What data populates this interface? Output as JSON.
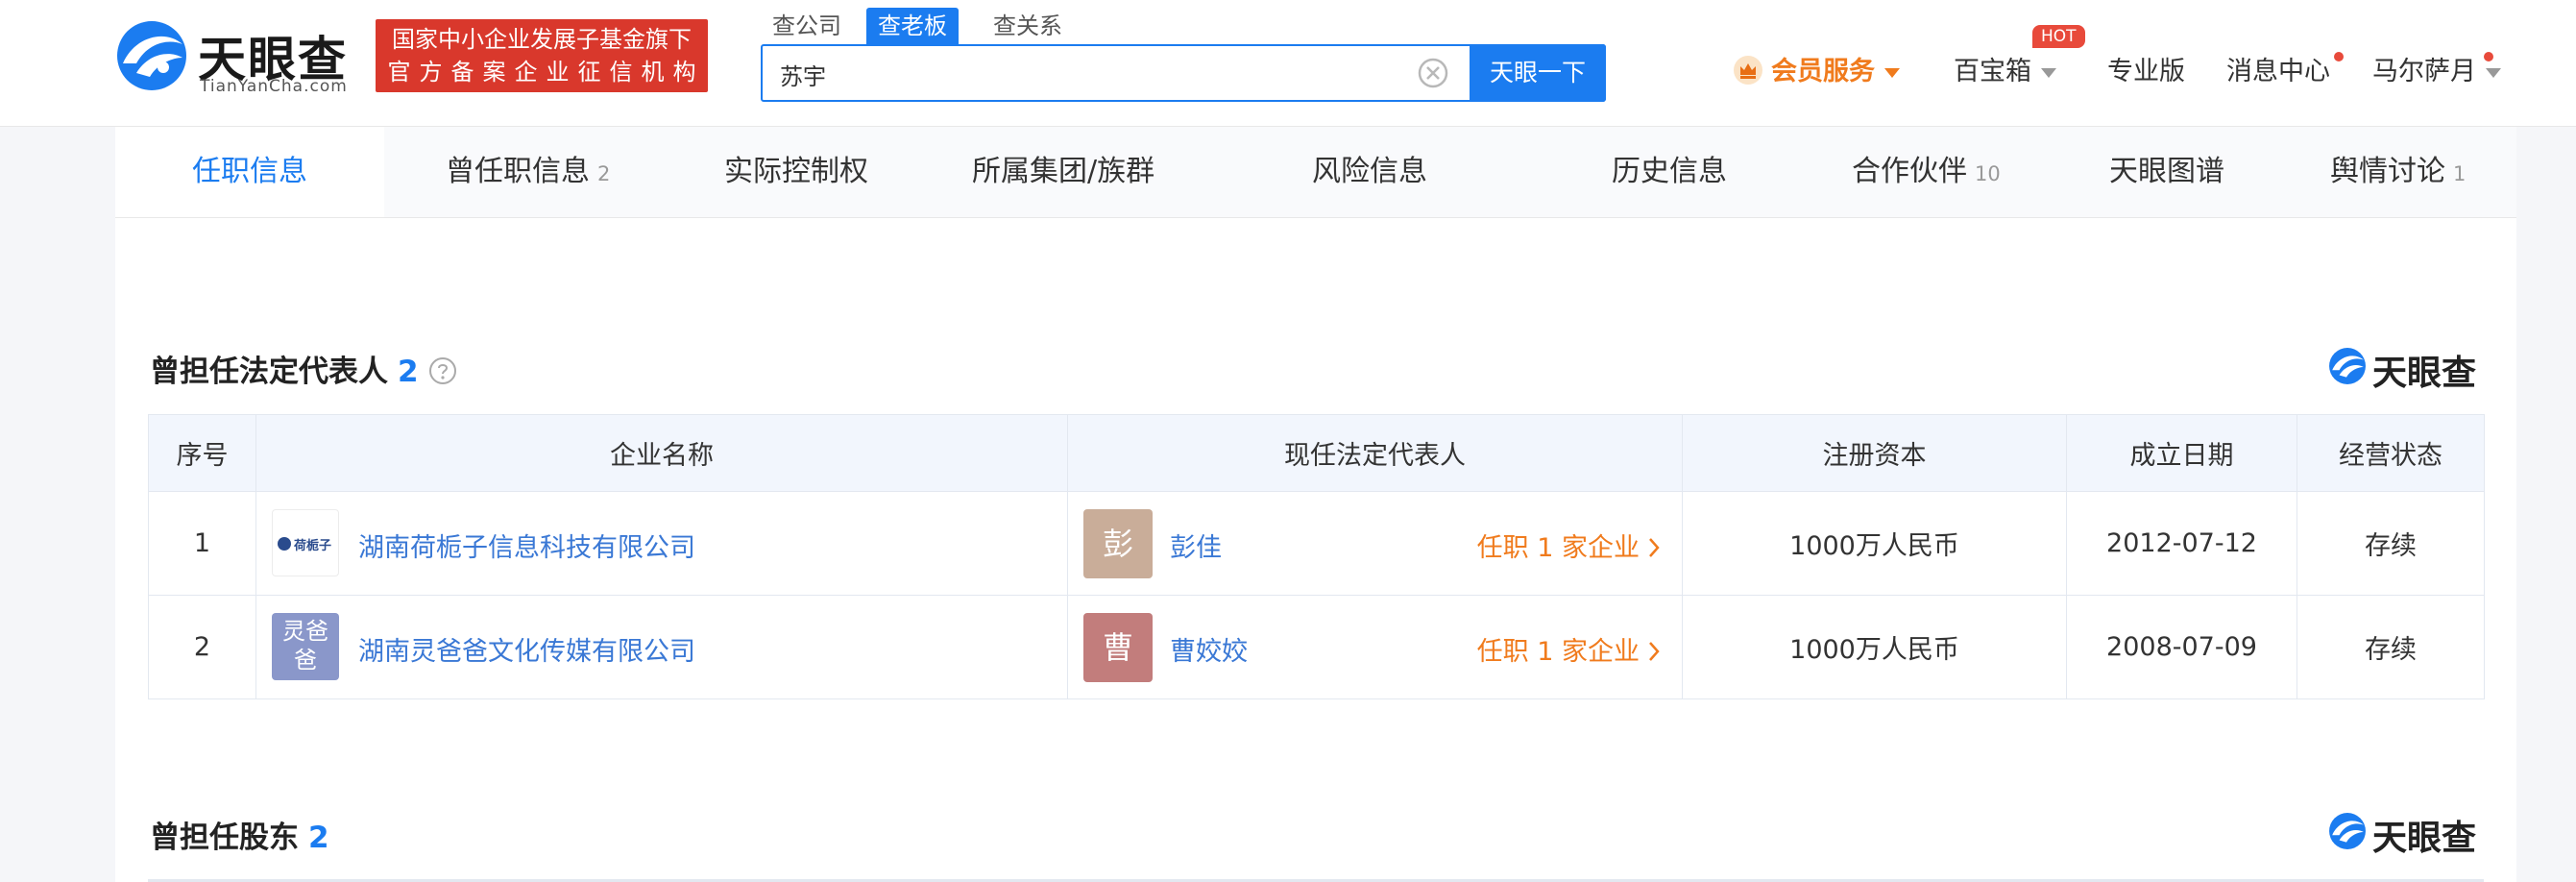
{
  "header": {
    "logo_cn": "天眼查",
    "logo_en": "TianYanCha.com",
    "badge_line1": "国家中小企业发展子基金旗下",
    "badge_line2": "官方备案企业征信机构",
    "search_tabs": [
      "查公司",
      "查老板",
      "查关系"
    ],
    "search_value": "苏宇",
    "search_button": "天眼一下",
    "nav": {
      "vip": "会员服务",
      "treasure": "百宝箱",
      "hot": "HOT",
      "pro": "专业版",
      "messages": "消息中心",
      "user": "马尔萨月"
    },
    "colors": {
      "accent": "#1b7cf0",
      "vip": "#f07b1d",
      "badge": "#d9382c"
    }
  },
  "tabs": [
    {
      "label": "任职信息",
      "count": ""
    },
    {
      "label": "曾任职信息",
      "count": "2"
    },
    {
      "label": "实际控制权",
      "count": ""
    },
    {
      "label": "所属集团/族群",
      "count": ""
    },
    {
      "label": "风险信息",
      "count": ""
    },
    {
      "label": "历史信息",
      "count": ""
    },
    {
      "label": "合作伙伴",
      "count": "10"
    },
    {
      "label": "天眼图谱",
      "count": ""
    },
    {
      "label": "舆情讨论",
      "count": "1"
    }
  ],
  "section_legal": {
    "title": "曾担任法定代表人",
    "count": "2",
    "watermark": "天眼查",
    "columns": [
      "序号",
      "企业名称",
      "现任法定代表人",
      "注册资本",
      "成立日期",
      "经营状态"
    ],
    "rows": [
      {
        "index": "1",
        "logo_text": "荷栀子",
        "company": "湖南荷栀子信息科技有限公司",
        "avatar": "彭",
        "avatar_color": "#c9ad99",
        "rep": "彭佳",
        "rep_link": "任职 1 家企业",
        "capital": "1000万人民币",
        "date": "2012-07-12",
        "status": "存续"
      },
      {
        "index": "2",
        "logo_line1": "灵爸",
        "logo_line2": "爸",
        "company": "湖南灵爸爸文化传媒有限公司",
        "avatar": "曹",
        "avatar_color": "#c27d7c",
        "rep": "曹姣姣",
        "rep_link": "任职 1 家企业",
        "capital": "1000万人民币",
        "date": "2008-07-09",
        "status": "存续"
      }
    ]
  },
  "section_shareholder": {
    "title": "曾担任股东",
    "count": "2",
    "watermark": "天眼查"
  }
}
